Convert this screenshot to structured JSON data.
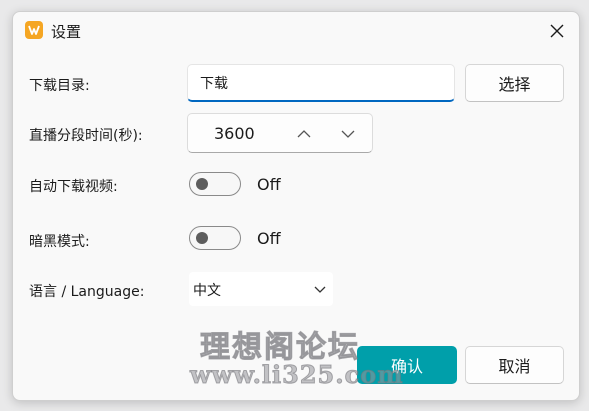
{
  "window": {
    "title": "设置",
    "accent_color": "#0067c0",
    "primary_button_color": "#009faa"
  },
  "download_dir": {
    "label": "下载目录:",
    "value": "下载",
    "browse_label": "选择"
  },
  "segment_duration": {
    "label": "直播分段时间(秒):",
    "value": "3600"
  },
  "auto_download": {
    "label": "自动下载视频:",
    "state": "Off"
  },
  "dark_mode": {
    "label": "暗黑模式:",
    "state": "Off"
  },
  "language": {
    "label": "语言 / Language:",
    "selected": "中文"
  },
  "footer": {
    "confirm_label": "确认",
    "cancel_label": "取消"
  },
  "watermark": {
    "line1": "理想阁论坛",
    "line2": "www.li325.com"
  }
}
